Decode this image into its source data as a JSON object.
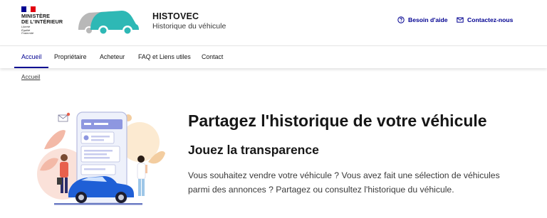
{
  "brand": {
    "ministry_line1": "MINISTÈRE",
    "ministry_line2": "DE L'INTÉRIEUR",
    "motto_1": "Liberté",
    "motto_2": "Égalité",
    "motto_3": "Fraternité",
    "flag_colors": [
      "#000091",
      "#ffffff",
      "#e1000f"
    ],
    "logo_colors": {
      "car_back": "#b8b8b8",
      "car_front": "#2eb8b5"
    }
  },
  "header": {
    "title": "HISTOVEC",
    "subtitle": "Historique du véhicule",
    "tools": [
      {
        "label": "Besoin d'aide",
        "icon": "question-circle-icon"
      },
      {
        "label": "Contactez-nous",
        "icon": "mail-icon"
      }
    ]
  },
  "nav": {
    "items": [
      {
        "label": "Accueil",
        "active": true
      },
      {
        "label": "Propriétaire",
        "active": false
      },
      {
        "label": "Acheteur",
        "active": false
      },
      {
        "label": "FAQ et Liens utiles",
        "active": false
      },
      {
        "label": "Contact",
        "active": false
      }
    ]
  },
  "breadcrumb": {
    "current": "Accueil"
  },
  "hero": {
    "title": "Partagez l'historique de votre véhicule",
    "subtitle": "Jouez la transparence",
    "text": "Vous souhaitez vendre votre véhicule ? Vous avez fait une sélection de véhicules parmi des annonces ? Partagez ou consultez l'historique du véhicule."
  },
  "colors": {
    "accent": "#000091",
    "text": "#161616"
  }
}
